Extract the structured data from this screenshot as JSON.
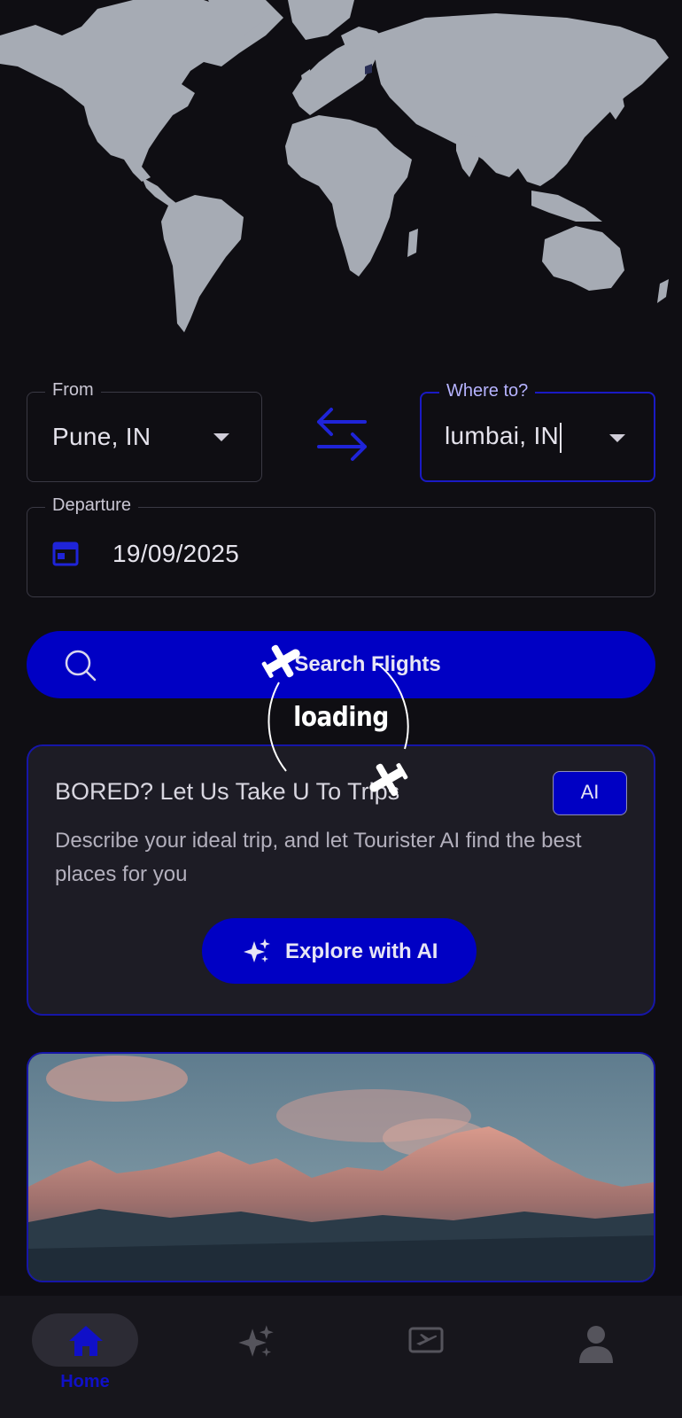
{
  "search": {
    "from_label": "From",
    "from_value": "Pune, IN",
    "to_label": "Where to?",
    "to_value": "lumbai, IN",
    "departure_label": "Departure",
    "departure_value": "19/09/2025",
    "search_button_label": "Search Flights"
  },
  "loading": {
    "text": "loading"
  },
  "ai_card": {
    "title": "BORED? Let Us Take U To Trips",
    "badge": "AI",
    "description": "Describe your ideal trip, and let Tourister AI find the best places for you",
    "button_label": "Explore with AI"
  },
  "bottom_nav": {
    "items": [
      {
        "label": "Home",
        "icon": "home-icon",
        "active": true
      },
      {
        "label": "",
        "icon": "sparkle-icon",
        "active": false
      },
      {
        "label": "",
        "icon": "ticket-icon",
        "active": false
      },
      {
        "label": "",
        "icon": "profile-icon",
        "active": false
      }
    ]
  },
  "colors": {
    "background": "#0f0e13",
    "accent": "#0000c4",
    "card": "#1d1c25",
    "map_land": "#a6abb4"
  }
}
